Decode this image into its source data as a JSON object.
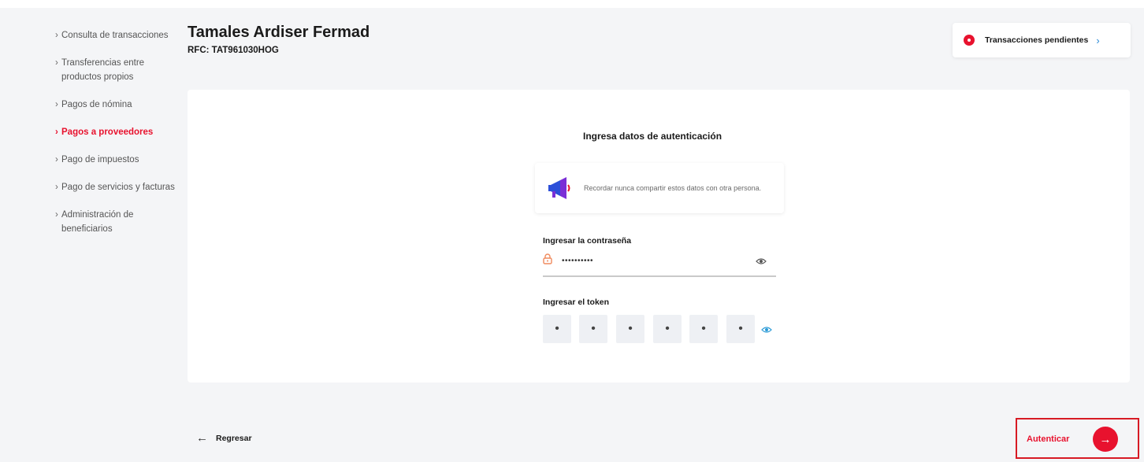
{
  "sidebar": {
    "items": [
      {
        "label": "Consulta de transacciones",
        "active": false
      },
      {
        "label": "Transferencias entre productos propios",
        "active": false
      },
      {
        "label": "Pagos de nómina",
        "active": false
      },
      {
        "label": "Pagos a proveedores",
        "active": true
      },
      {
        "label": "Pago de impuestos",
        "active": false
      },
      {
        "label": "Pago de servicios y facturas",
        "active": false
      },
      {
        "label": "Administración de beneficiarios",
        "active": false
      }
    ],
    "chevron": "›"
  },
  "header": {
    "company_name": "Tamales Ardiser Fermad",
    "rfc": "RFC: TAT961030HOG"
  },
  "pending": {
    "label": "Transacciones pendientes",
    "chevron": "›",
    "icon": "alert-dot-icon"
  },
  "auth_form": {
    "title": "Ingresa datos de autenticación",
    "notice": "Recordar nunca compartir estos datos con otra persona.",
    "notice_icon": "megaphone-icon",
    "password_label": "Ingresar la contraseña",
    "password_value": "••••••••••",
    "password_icon": "lock-icon",
    "token_label": "Ingresar el token",
    "token_digits": [
      "•",
      "•",
      "•",
      "•",
      "•",
      "•"
    ]
  },
  "footer": {
    "back_arrow": "←",
    "back_label": "Regresar",
    "authenticate_label": "Autenticar",
    "authenticate_arrow": "→"
  },
  "colors": {
    "accent": "#e8122e",
    "background": "#f4f5f7",
    "card": "#ffffff",
    "highlight_border": "#d71a24"
  }
}
